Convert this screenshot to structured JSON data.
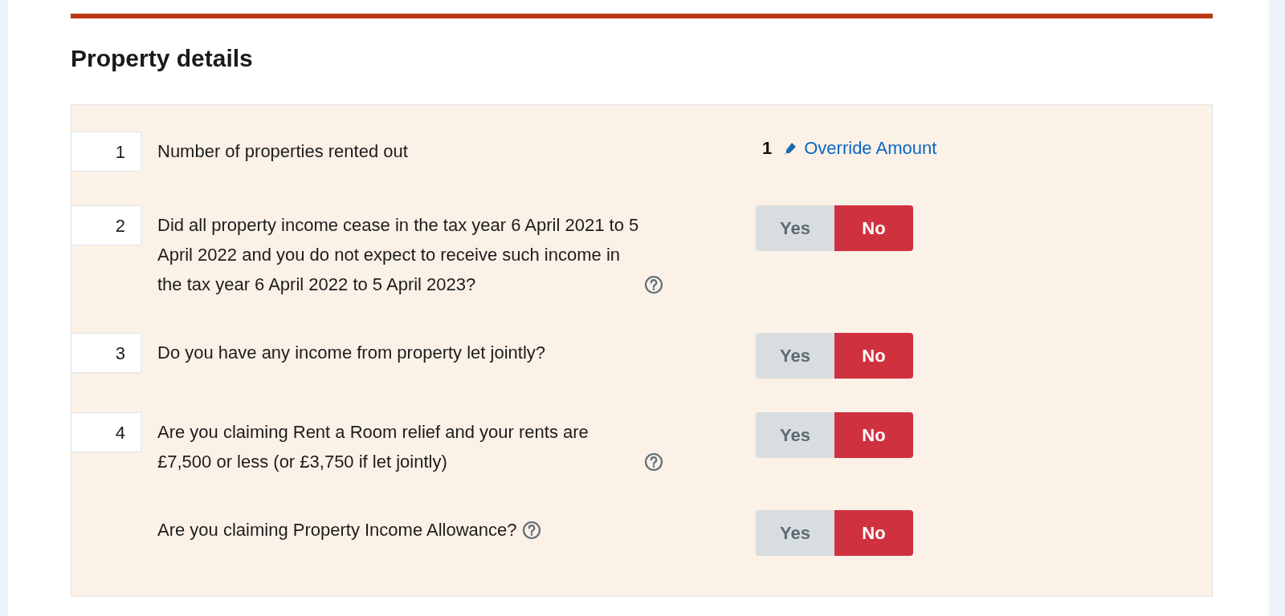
{
  "section": {
    "title": "Property details"
  },
  "questions": [
    {
      "number": "1",
      "text": "Number of properties rented out",
      "help": false,
      "answer": {
        "kind": "amount",
        "value": "1",
        "link": "Override Amount"
      }
    },
    {
      "number": "2",
      "text": "Did all property income cease in the tax year 6 April 2021 to 5 April 2022 and you do not expect to receive such income in the tax year 6 April 2022 to 5 April 2023?",
      "help": true,
      "answer": {
        "kind": "toggle",
        "options": [
          {
            "label": "Yes",
            "selected": false
          },
          {
            "label": "No",
            "selected": true
          }
        ]
      }
    },
    {
      "number": "3",
      "text": "Do you have any income from property let jointly?",
      "help": false,
      "answer": {
        "kind": "toggle",
        "options": [
          {
            "label": "Yes",
            "selected": false
          },
          {
            "label": "No",
            "selected": true
          }
        ]
      }
    },
    {
      "number": "4",
      "text": "Are you claiming Rent a Room relief and your rents are £7,500 or less (or £3,750 if let jointly)",
      "help": true,
      "answer": {
        "kind": "toggle",
        "options": [
          {
            "label": "Yes",
            "selected": false
          },
          {
            "label": "No",
            "selected": true
          }
        ]
      }
    },
    {
      "text": "Are you claiming Property Income Allowance?",
      "help": true,
      "answer": {
        "kind": "toggle",
        "options": [
          {
            "label": "Yes",
            "selected": false
          },
          {
            "label": "No",
            "selected": true
          }
        ]
      }
    }
  ]
}
